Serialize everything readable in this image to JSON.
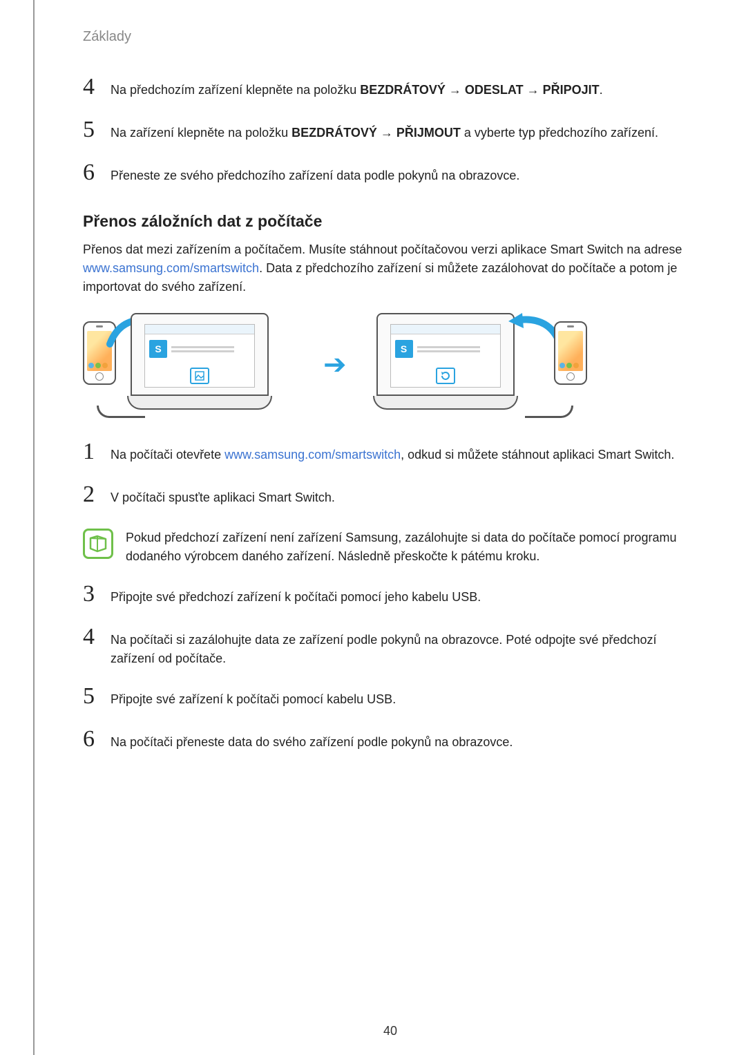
{
  "header": {
    "section": "Základy"
  },
  "stepsA": {
    "s4": {
      "num": "4",
      "pre": "Na předchozím zařízení klepněte na položku ",
      "b1": "BEZDRÁTOVÝ",
      "a1": " → ",
      "b2": "ODESLAT",
      "a2": " → ",
      "b3": "PŘIPOJIT",
      "post": "."
    },
    "s5": {
      "num": "5",
      "pre": "Na zařízení klepněte na položku ",
      "b1": "BEZDRÁTOVÝ",
      "a1": " → ",
      "b2": "PŘIJMOUT",
      "post": " a vyberte typ předchozího zařízení."
    },
    "s6": {
      "num": "6",
      "text": "Přeneste ze svého předchozího zařízení data podle pokynů na obrazovce."
    }
  },
  "section2": {
    "title": "Přenos záložních dat z počítače",
    "para_pre": "Přenos dat mezi zařízením a počítačem. Musíte stáhnout počítačovou verzi aplikace Smart Switch na adrese ",
    "link": "www.samsung.com/smartswitch",
    "link_href": "http://www.samsung.com/smartswitch",
    "para_post": ". Data z předchozího zařízení si můžete zazálohovat do počítače a potom je importovat do svého zařízení."
  },
  "diagram": {
    "app_letter": "S"
  },
  "stepsB": {
    "s1": {
      "num": "1",
      "pre": "Na počítači otevřete ",
      "link": "www.samsung.com/smartswitch",
      "link_href": "http://www.samsung.com/smartswitch",
      "post": ", odkud si můžete stáhnout aplikaci Smart Switch."
    },
    "s2": {
      "num": "2",
      "text": "V počítači spusťte aplikaci Smart Switch."
    },
    "note": "Pokud předchozí zařízení není zařízení Samsung, zazálohujte si data do počítače pomocí programu dodaného výrobcem daného zařízení. Následně přeskočte k pátému kroku.",
    "s3": {
      "num": "3",
      "text": "Připojte své předchozí zařízení k počítači pomocí jeho kabelu USB."
    },
    "s4": {
      "num": "4",
      "text": "Na počítači si zazálohujte data ze zařízení podle pokynů na obrazovce. Poté odpojte své předchozí zařízení od počítače."
    },
    "s5": {
      "num": "5",
      "text": "Připojte své zařízení k počítači pomocí kabelu USB."
    },
    "s6": {
      "num": "6",
      "text": "Na počítači přeneste data do svého zařízení podle pokynů na obrazovce."
    }
  },
  "page_number": "40"
}
